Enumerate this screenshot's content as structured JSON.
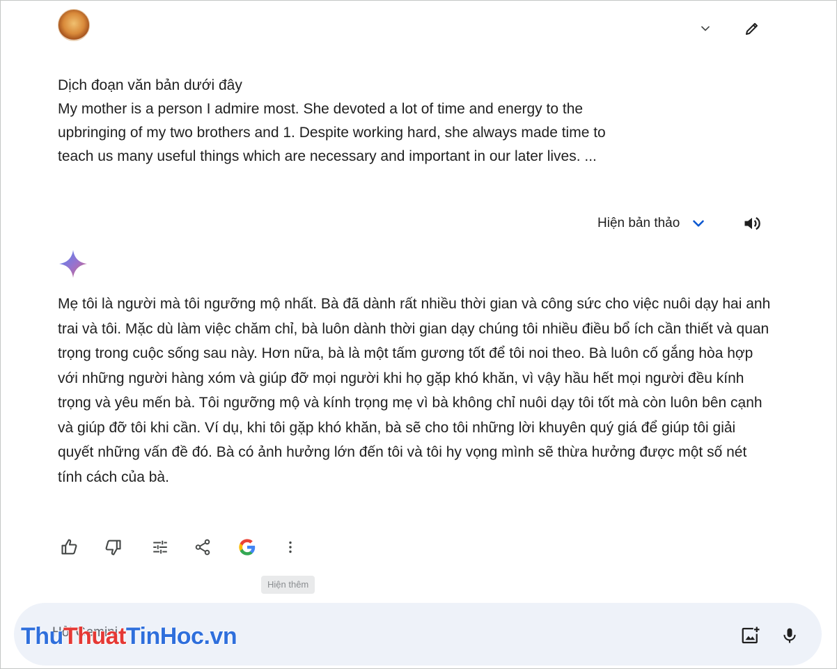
{
  "prompt": {
    "lines": [
      "Dịch đoạn văn bản dưới đây",
      "My mother is a person I admire most. She devoted a lot of time and energy to the",
      "upbringing of my two brothers and 1. Despite working hard, she always made time to",
      "teach us many useful things which are necessary and important in our later lives. ..."
    ]
  },
  "drafts": {
    "label": "Hiện bản thảo"
  },
  "response": {
    "text": "Mẹ tôi là người mà tôi ngưỡng mộ nhất. Bà đã dành rất nhiều thời gian và công sức cho việc nuôi dạy hai anh trai và tôi. Mặc dù làm việc chăm chỉ, bà luôn dành thời gian dạy chúng tôi nhiều điều bổ ích cần thiết và quan trọng trong cuộc sống sau này. Hơn nữa, bà là một tấm gương tốt để tôi noi theo. Bà luôn cố gắng hòa hợp với những người hàng xóm và giúp đỡ mọi người khi họ gặp khó khăn, vì vậy hầu hết mọi người đều kính trọng và yêu mến bà. Tôi ngưỡng mộ và kính trọng mẹ vì bà không chỉ nuôi dạy tôi tốt mà còn luôn bên cạnh và giúp đỡ tôi khi cần. Ví dụ, khi tôi gặp khó khăn, bà sẽ cho tôi những lời khuyên quý giá để giúp tôi giải quyết những vấn đề đó. Bà có ảnh hưởng lớn đến tôi và tôi hy vọng mình sẽ thừa hưởng được một số nét tính cách của bà."
  },
  "actions": {
    "tooltip": "Hiện thêm",
    "icons": [
      "thumb-up-icon",
      "thumb-down-icon",
      "tune-icon",
      "share-icon",
      "google-icon",
      "more-vert-icon"
    ]
  },
  "input": {
    "placeholder": "Hỏi Gemini"
  },
  "watermark": {
    "part1": "Thu",
    "part2": "Thuat",
    "part3": "TinHoc.vn"
  },
  "colors": {
    "accent": "#0b57d0",
    "input_bg": "#eef2f9",
    "icon": "#444746"
  }
}
